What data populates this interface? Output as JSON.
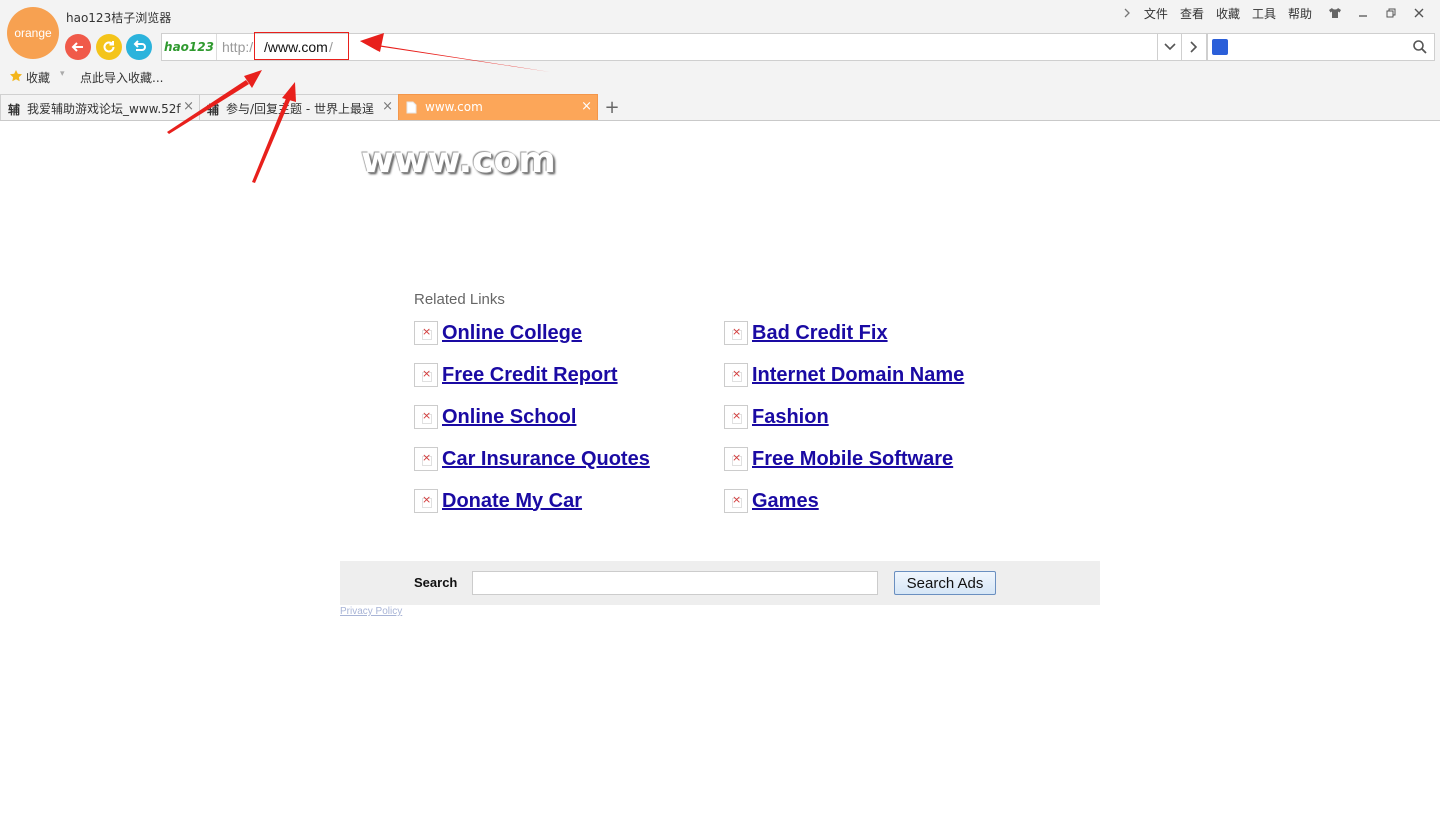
{
  "browser": {
    "logo_text": "orange",
    "app_title": "hao123桔子浏览器",
    "menu": [
      "文件",
      "查看",
      "收藏",
      "工具",
      "帮助"
    ],
    "address": {
      "badge": "hao123",
      "protocol": "http:/",
      "host": "/www.com",
      "trailing": "/"
    },
    "favorites": {
      "label": "收藏",
      "import_label": "点此导入收藏..."
    },
    "tabs": [
      {
        "icon": "辅",
        "title": "我爱辅助游戏论坛_www.52f"
      },
      {
        "icon": "辅",
        "title": "参与/回复主题 - 世界上最逞"
      },
      {
        "icon": "page-icon",
        "title": "www.com",
        "active": true
      }
    ],
    "new_tab_label": "+"
  },
  "page": {
    "site_logo": "www.com",
    "related_heading": "Related Links",
    "links_left": [
      "Online College",
      "Free Credit Report",
      "Online School",
      "Car Insurance Quotes",
      "Donate My Car"
    ],
    "links_right": [
      "Bad Credit Fix",
      "Internet Domain Name",
      "Fashion",
      "Free Mobile Software",
      "Games"
    ],
    "search": {
      "label": "Search",
      "button_label": "Search Ads",
      "value": ""
    },
    "privacy_label": "Privacy Policy"
  },
  "colors": {
    "accent_orange": "#fca659",
    "link": "#1a0aa3",
    "annotation_red": "#e8201c"
  }
}
